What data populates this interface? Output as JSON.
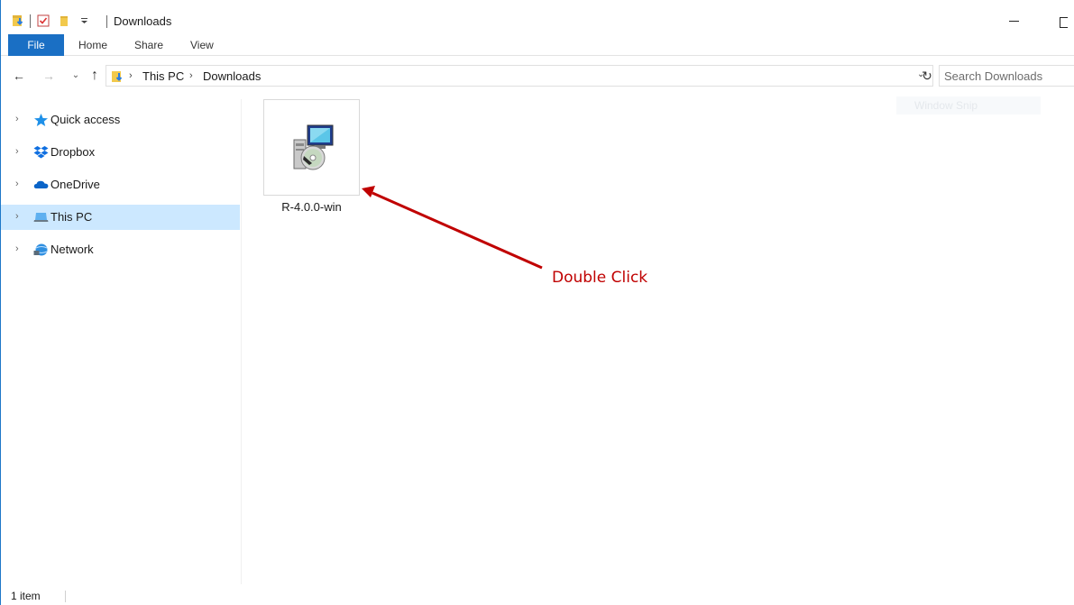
{
  "window": {
    "title": "Downloads",
    "accent_color": "#1a6fc4"
  },
  "quick_access_toolbar": {
    "icons": [
      "folder-download-icon",
      "properties-checkmark-icon",
      "new-folder-icon",
      "customize-dropdown-icon"
    ]
  },
  "ribbon": {
    "tabs": [
      {
        "label": "File"
      },
      {
        "label": "Home"
      },
      {
        "label": "Share"
      },
      {
        "label": "View"
      }
    ]
  },
  "address_bar": {
    "breadcrumbs": [
      "This PC",
      "Downloads"
    ],
    "search_placeholder": "Search Downloads"
  },
  "nav_pane": {
    "items": [
      {
        "label": "Quick access",
        "icon": "star-icon"
      },
      {
        "label": "Dropbox",
        "icon": "dropbox-icon"
      },
      {
        "label": "OneDrive",
        "icon": "cloud-icon"
      },
      {
        "label": "This PC",
        "icon": "computer-icon",
        "selected": true
      },
      {
        "label": "Network",
        "icon": "network-icon"
      }
    ]
  },
  "files": [
    {
      "name": "R-4.0.0-win",
      "icon": "installer-icon",
      "selected": false
    }
  ],
  "ghost_label": "Window Snip",
  "annotation": {
    "text": "Double Click",
    "color": "#c00000"
  },
  "status_bar": {
    "item_count": "1 item"
  }
}
